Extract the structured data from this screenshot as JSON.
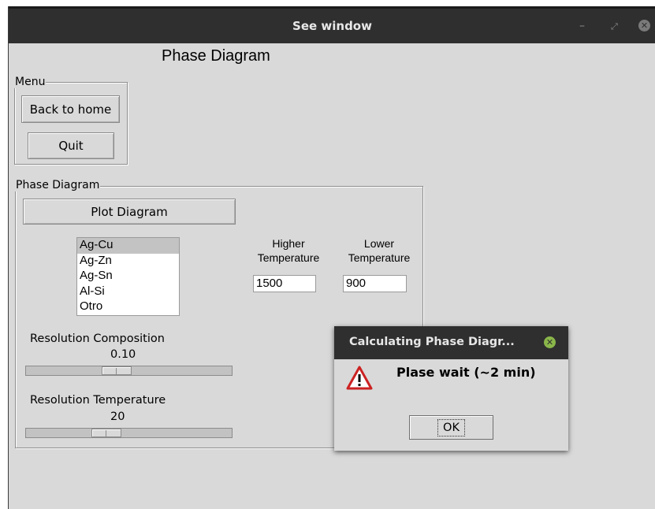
{
  "window": {
    "title": "See window"
  },
  "page": {
    "heading": "Phase Diagram"
  },
  "menu": {
    "legend": "Menu",
    "back_label": "Back to home",
    "quit_label": "Quit"
  },
  "phase": {
    "legend": "Phase Diagram",
    "plot_label": "Plot Diagram",
    "alloys": [
      "Ag-Cu",
      "Ag-Zn",
      "Ag-Sn",
      "Al-Si",
      "Otro"
    ],
    "selected_alloy": "Ag-Cu",
    "higher_temp_label_1": "Higher",
    "higher_temp_label_2": "Temperature",
    "lower_temp_label_1": "Lower",
    "lower_temp_label_2": "Temperature",
    "higher_temp_value": "1500",
    "lower_temp_value": "900",
    "res_comp_label": "Resolution Composition",
    "res_comp_value": "0.10",
    "res_comp_level": 0.43,
    "res_temp_label": "Resolution Temperature",
    "res_temp_value": "20",
    "res_temp_level": 0.37
  },
  "dialog": {
    "title": "Calculating Phase Diagr...",
    "message": "Plase wait (~2 min)",
    "ok_label": "OK",
    "icon": "warning-icon"
  },
  "colors": {
    "titlebar": "#2f2f2f",
    "window_bg": "#d9d9d9",
    "dialog_close": "#8ab64a",
    "warning": "#cc2222"
  }
}
